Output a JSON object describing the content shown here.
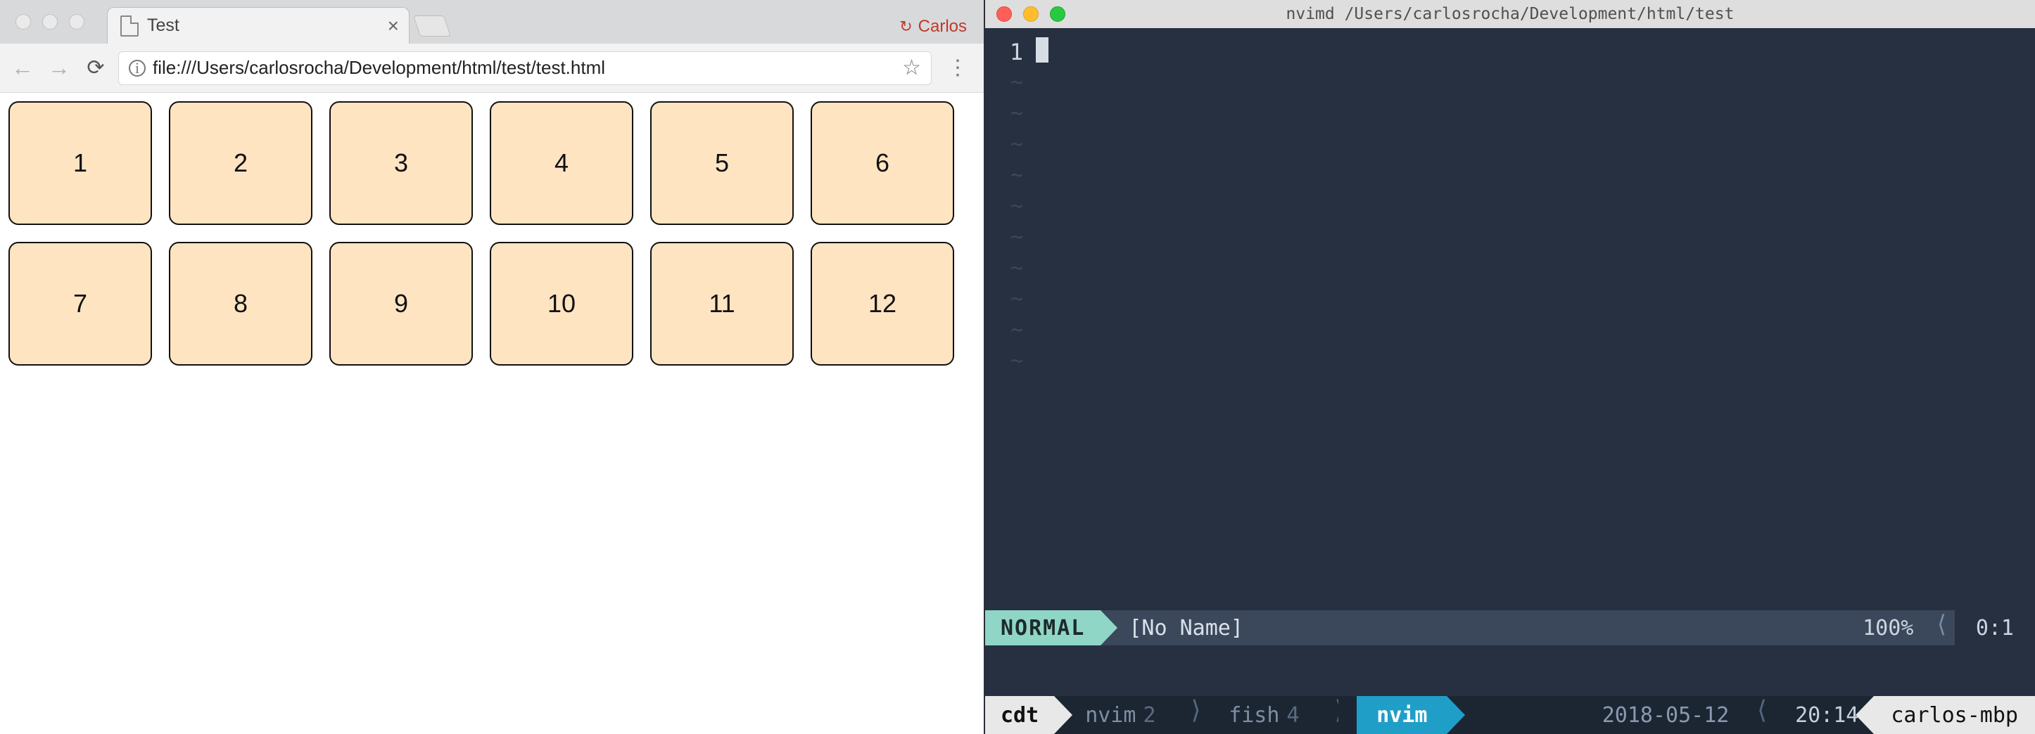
{
  "browser": {
    "tab_title": "Test",
    "profile_name": "Carlos",
    "url": "file:///Users/carlosrocha/Development/html/test/test.html",
    "grid_items": [
      "1",
      "2",
      "3",
      "4",
      "5",
      "6",
      "7",
      "8",
      "9",
      "10",
      "11",
      "12"
    ]
  },
  "terminal": {
    "title": "nvimd  /Users/carlosrocha/Development/html/test",
    "line_number": "1",
    "tilde": "~",
    "tilde_count": 10,
    "vim": {
      "mode": "NORMAL",
      "buffer_name": "[No Name]",
      "percent": "100%",
      "position": "0:1"
    },
    "tmux": {
      "session": "cdt",
      "windows": [
        {
          "name": "nvim",
          "index": "2",
          "active": false
        },
        {
          "name": "fish",
          "index": "4",
          "active": false
        },
        {
          "name": "nvim",
          "index": "",
          "active": true
        }
      ],
      "date": "2018-05-12",
      "time": "20:14",
      "host": "carlos-mbp"
    }
  }
}
